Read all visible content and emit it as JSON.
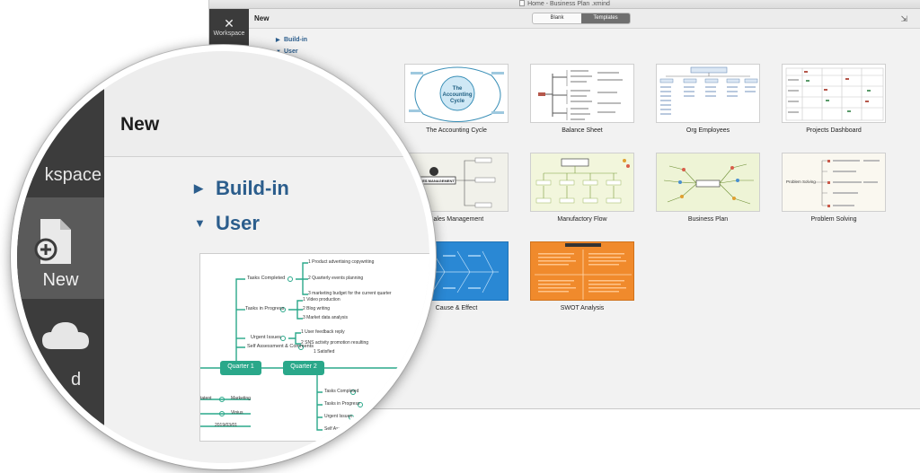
{
  "window": {
    "title": "Home - Business Plan .xmind",
    "sidebar": {
      "workspace_label": "Workspace"
    },
    "toolbar": {
      "page_title": "New",
      "tabs": [
        {
          "label": "Blank",
          "active": false
        },
        {
          "label": "Templates",
          "active": true
        }
      ]
    },
    "groups": {
      "builtin": "Build-in",
      "user": "User"
    },
    "templates": [
      {
        "name": "The Accounting Cycle",
        "thumb_text": "The Accounting Cycle",
        "bg": "#ffffff"
      },
      {
        "name": "Balance Sheet",
        "bg": "#ffffff"
      },
      {
        "name": "Org Employees",
        "bg": "#ffffff"
      },
      {
        "name": "Projects Dashboard",
        "bg": "#ffffff"
      },
      {
        "name": "Sales Management",
        "thumb_text": "SALES MANAGEMENT",
        "bg": "#f1f1ea"
      },
      {
        "name": "Manufactory Flow",
        "bg": "#f2f6dc"
      },
      {
        "name": "Business Plan",
        "bg": "#eef4d6"
      },
      {
        "name": "Problem Solving",
        "thumb_text": "Problem Solving",
        "bg": "#faf8f0"
      },
      {
        "name": "Cause & Effect",
        "bg": "#2a88d4"
      },
      {
        "name": "SWOT Analysis",
        "bg": "#f08a2c"
      }
    ]
  },
  "lens": {
    "page_title": "New",
    "sidebar": {
      "workspace_label": "kspace",
      "new_label": "New",
      "cloud_label": "d"
    },
    "groups": {
      "builtin": "Build-in",
      "user": "User"
    },
    "mindmap": {
      "quarter1": "Quarter 1",
      "quarter2": "Quarter 2",
      "branches": [
        {
          "label": "Tasks Completed",
          "items": [
            "1 Product advertising copywriting",
            "2 Quarterly events planning",
            "3 marketing budget for the current quarter"
          ]
        },
        {
          "label": "Tasks in Progress",
          "items": [
            "1 Video production",
            "2 Blog writing",
            "3 Market data analysis"
          ]
        },
        {
          "label": "Urgent Issues",
          "items": [
            "1 User feedback reply",
            "2 SNS activity promotion resulting"
          ]
        },
        {
          "label": "Self Assessment & Comments",
          "items": [
            "1 Satisfied"
          ]
        }
      ],
      "q2_items": [
        "Tasks Completed",
        "Tasks in Progress",
        "Urgent Issues",
        "Self Assem"
      ],
      "left_items": [
        "Marketing",
        "Vinius",
        "2019/03/01",
        "tatent"
      ]
    }
  },
  "colors": {
    "accent": "#2b5d8c",
    "mindmap_green": "#2aa88a",
    "sidebar": "#3b3b3b"
  }
}
